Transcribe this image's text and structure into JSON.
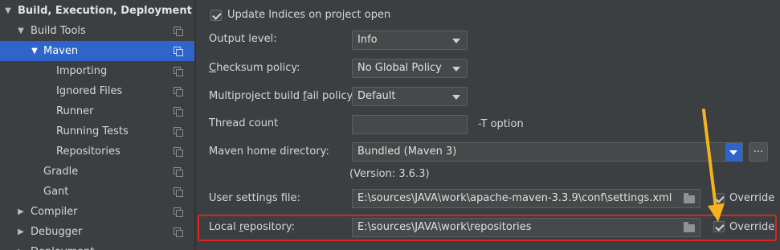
{
  "sidebar": {
    "items": [
      {
        "label": "Build, Execution, Deployment",
        "expanded": true
      },
      {
        "label": "Build Tools",
        "expanded": true
      },
      {
        "label": "Maven",
        "expanded": true,
        "selected": true
      },
      {
        "label": "Importing"
      },
      {
        "label": "Ignored Files"
      },
      {
        "label": "Runner"
      },
      {
        "label": "Running Tests"
      },
      {
        "label": "Repositories"
      },
      {
        "label": "Gradle"
      },
      {
        "label": "Gant"
      },
      {
        "label": "Compiler",
        "expanded": false
      },
      {
        "label": "Debugger",
        "expanded": false
      },
      {
        "label": "Deployment",
        "expanded": false
      }
    ]
  },
  "settings": {
    "update_indices": {
      "label": "Update Indices on project open",
      "checked": true
    },
    "output_level": {
      "label": "Output level:",
      "value": "Info"
    },
    "checksum_policy": {
      "label_pre": "",
      "label_ul": "C",
      "label_post": "hecksum policy:",
      "value": "No Global Policy"
    },
    "multiproject_policy": {
      "label_pre": "Multiproject build ",
      "label_ul": "f",
      "label_post": "ail policy:",
      "value": "Default"
    },
    "thread_count": {
      "label": "Thread count",
      "value": "",
      "suffix": "-T option"
    },
    "maven_home": {
      "label": "Maven home directory:",
      "value": "Bundled (Maven 3)",
      "browse": "...",
      "version": "(Version: 3.6.3)"
    },
    "user_settings": {
      "label": "User settings file:",
      "value": "E:\\sources\\JAVA\\work\\apache-maven-3.3.9\\conf\\settings.xml",
      "override_label": "Override",
      "override_checked": true
    },
    "local_repo": {
      "label_pre": "Local ",
      "label_ul": "r",
      "label_post": "epository:",
      "value": "E:\\sources\\JAVA\\work\\repositories",
      "override_label": "Override",
      "override_checked": true
    }
  },
  "colors": {
    "selection": "#2f65ca",
    "highlight_box": "#e0241b",
    "arrow": "#f6b21c",
    "dropdown_button": "#2f65ca"
  }
}
